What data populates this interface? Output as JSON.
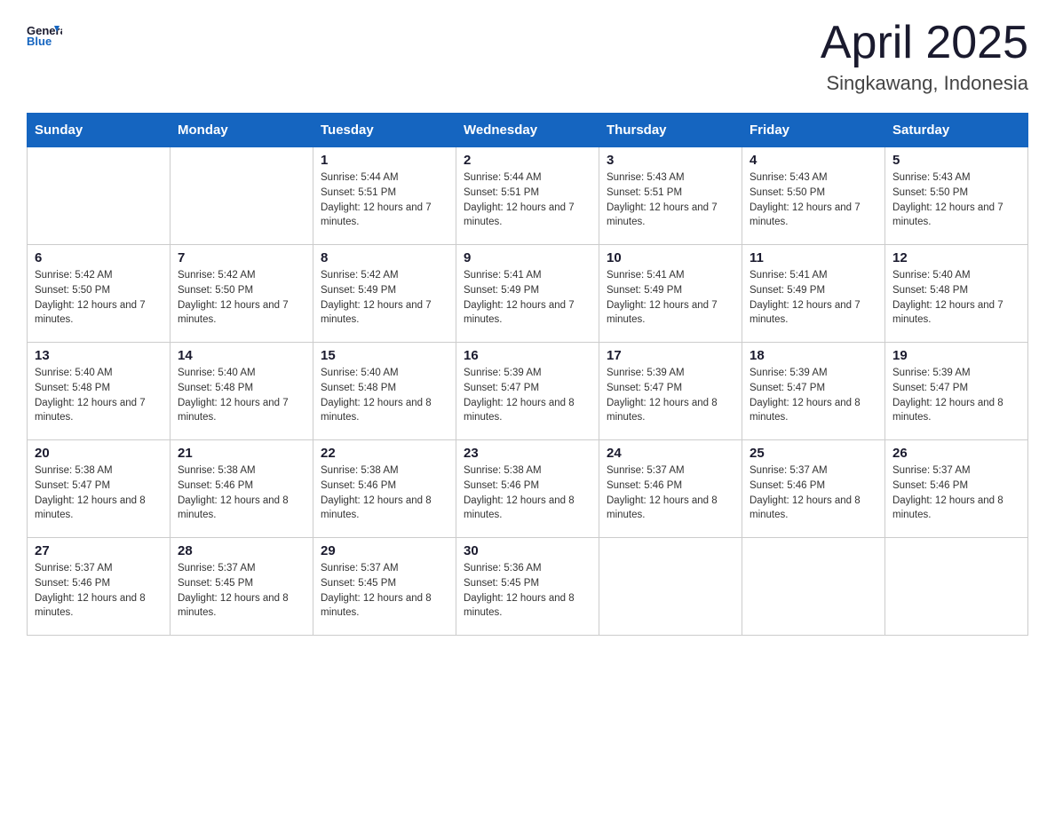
{
  "header": {
    "logo_general": "General",
    "logo_blue": "Blue",
    "month": "April 2025",
    "location": "Singkawang, Indonesia"
  },
  "weekdays": [
    "Sunday",
    "Monday",
    "Tuesday",
    "Wednesday",
    "Thursday",
    "Friday",
    "Saturday"
  ],
  "weeks": [
    [
      {
        "day": "",
        "sunrise": "",
        "sunset": "",
        "daylight": ""
      },
      {
        "day": "",
        "sunrise": "",
        "sunset": "",
        "daylight": ""
      },
      {
        "day": "1",
        "sunrise": "5:44 AM",
        "sunset": "5:51 PM",
        "daylight": "12 hours and 7 minutes."
      },
      {
        "day": "2",
        "sunrise": "5:44 AM",
        "sunset": "5:51 PM",
        "daylight": "12 hours and 7 minutes."
      },
      {
        "day": "3",
        "sunrise": "5:43 AM",
        "sunset": "5:51 PM",
        "daylight": "12 hours and 7 minutes."
      },
      {
        "day": "4",
        "sunrise": "5:43 AM",
        "sunset": "5:50 PM",
        "daylight": "12 hours and 7 minutes."
      },
      {
        "day": "5",
        "sunrise": "5:43 AM",
        "sunset": "5:50 PM",
        "daylight": "12 hours and 7 minutes."
      }
    ],
    [
      {
        "day": "6",
        "sunrise": "5:42 AM",
        "sunset": "5:50 PM",
        "daylight": "12 hours and 7 minutes."
      },
      {
        "day": "7",
        "sunrise": "5:42 AM",
        "sunset": "5:50 PM",
        "daylight": "12 hours and 7 minutes."
      },
      {
        "day": "8",
        "sunrise": "5:42 AM",
        "sunset": "5:49 PM",
        "daylight": "12 hours and 7 minutes."
      },
      {
        "day": "9",
        "sunrise": "5:41 AM",
        "sunset": "5:49 PM",
        "daylight": "12 hours and 7 minutes."
      },
      {
        "day": "10",
        "sunrise": "5:41 AM",
        "sunset": "5:49 PM",
        "daylight": "12 hours and 7 minutes."
      },
      {
        "day": "11",
        "sunrise": "5:41 AM",
        "sunset": "5:49 PM",
        "daylight": "12 hours and 7 minutes."
      },
      {
        "day": "12",
        "sunrise": "5:40 AM",
        "sunset": "5:48 PM",
        "daylight": "12 hours and 7 minutes."
      }
    ],
    [
      {
        "day": "13",
        "sunrise": "5:40 AM",
        "sunset": "5:48 PM",
        "daylight": "12 hours and 7 minutes."
      },
      {
        "day": "14",
        "sunrise": "5:40 AM",
        "sunset": "5:48 PM",
        "daylight": "12 hours and 7 minutes."
      },
      {
        "day": "15",
        "sunrise": "5:40 AM",
        "sunset": "5:48 PM",
        "daylight": "12 hours and 8 minutes."
      },
      {
        "day": "16",
        "sunrise": "5:39 AM",
        "sunset": "5:47 PM",
        "daylight": "12 hours and 8 minutes."
      },
      {
        "day": "17",
        "sunrise": "5:39 AM",
        "sunset": "5:47 PM",
        "daylight": "12 hours and 8 minutes."
      },
      {
        "day": "18",
        "sunrise": "5:39 AM",
        "sunset": "5:47 PM",
        "daylight": "12 hours and 8 minutes."
      },
      {
        "day": "19",
        "sunrise": "5:39 AM",
        "sunset": "5:47 PM",
        "daylight": "12 hours and 8 minutes."
      }
    ],
    [
      {
        "day": "20",
        "sunrise": "5:38 AM",
        "sunset": "5:47 PM",
        "daylight": "12 hours and 8 minutes."
      },
      {
        "day": "21",
        "sunrise": "5:38 AM",
        "sunset": "5:46 PM",
        "daylight": "12 hours and 8 minutes."
      },
      {
        "day": "22",
        "sunrise": "5:38 AM",
        "sunset": "5:46 PM",
        "daylight": "12 hours and 8 minutes."
      },
      {
        "day": "23",
        "sunrise": "5:38 AM",
        "sunset": "5:46 PM",
        "daylight": "12 hours and 8 minutes."
      },
      {
        "day": "24",
        "sunrise": "5:37 AM",
        "sunset": "5:46 PM",
        "daylight": "12 hours and 8 minutes."
      },
      {
        "day": "25",
        "sunrise": "5:37 AM",
        "sunset": "5:46 PM",
        "daylight": "12 hours and 8 minutes."
      },
      {
        "day": "26",
        "sunrise": "5:37 AM",
        "sunset": "5:46 PM",
        "daylight": "12 hours and 8 minutes."
      }
    ],
    [
      {
        "day": "27",
        "sunrise": "5:37 AM",
        "sunset": "5:46 PM",
        "daylight": "12 hours and 8 minutes."
      },
      {
        "day": "28",
        "sunrise": "5:37 AM",
        "sunset": "5:45 PM",
        "daylight": "12 hours and 8 minutes."
      },
      {
        "day": "29",
        "sunrise": "5:37 AM",
        "sunset": "5:45 PM",
        "daylight": "12 hours and 8 minutes."
      },
      {
        "day": "30",
        "sunrise": "5:36 AM",
        "sunset": "5:45 PM",
        "daylight": "12 hours and 8 minutes."
      },
      {
        "day": "",
        "sunrise": "",
        "sunset": "",
        "daylight": ""
      },
      {
        "day": "",
        "sunrise": "",
        "sunset": "",
        "daylight": ""
      },
      {
        "day": "",
        "sunrise": "",
        "sunset": "",
        "daylight": ""
      }
    ]
  ]
}
